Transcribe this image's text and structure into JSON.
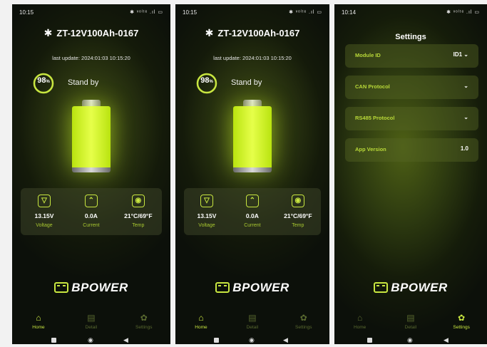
{
  "colors": {
    "accent": "#c8e640",
    "battery_fill": "#d8f830",
    "inactive_nav": "#5a6a30"
  },
  "home_screens": [
    {
      "status_time": "10:15",
      "status_icons": "✱ ᵛᵒˡᵗᵉ .ıl ▭",
      "device_title": "ZT-12V100Ah-0167",
      "bluetooth_icon": "bluetooth-icon",
      "last_update": "last update: 2024:01:03 10:15:20",
      "soc_value": "98",
      "soc_unit": "%",
      "soc_fraction": 0.98,
      "state": "Stand by",
      "metrics": [
        {
          "icon": "voltage-icon",
          "glyph": "▽",
          "value": "13.15V",
          "label": "Voltage"
        },
        {
          "icon": "current-icon",
          "glyph": "⌃",
          "value": "0.0A",
          "label": "Current"
        },
        {
          "icon": "thermometer-icon",
          "glyph": "◉",
          "value": "21°C/69°F",
          "label": "Temp"
        }
      ]
    },
    {
      "status_time": "10:15",
      "status_icons": "✱ ᵛᵒˡᵗᵉ .ıl ▭",
      "device_title": "ZT-12V100Ah-0167",
      "bluetooth_icon": "bluetooth-icon",
      "last_update": "last update: 2024:01:03 10:15:20",
      "soc_value": "98",
      "soc_unit": "%",
      "soc_fraction": 0.98,
      "state": "Stand by",
      "metrics": [
        {
          "icon": "voltage-icon",
          "glyph": "▽",
          "value": "13.15V",
          "label": "Voltage"
        },
        {
          "icon": "current-icon",
          "glyph": "⌃",
          "value": "0.0A",
          "label": "Current"
        },
        {
          "icon": "thermometer-icon",
          "glyph": "◉",
          "value": "21°C/69°F",
          "label": "Temp"
        }
      ]
    }
  ],
  "settings_screen": {
    "status_time": "10:14",
    "status_icons": "✱ ᵛᵒˡᵗᵉ .ıl ▭",
    "title": "Settings",
    "rows": [
      {
        "label": "Module ID",
        "value": "ID1 ⌄"
      },
      {
        "label": "CAN Protocol",
        "value": "⌄"
      },
      {
        "label": "RS485 Protocol",
        "value": "⌄"
      },
      {
        "label": "App Version",
        "value": "1.0"
      }
    ]
  },
  "brand": {
    "logo_text": "BPOWER",
    "logo_icon": "battery-logo-icon"
  },
  "nav": [
    {
      "label": "Home",
      "icon": "home-icon",
      "glyph": "⌂"
    },
    {
      "label": "Detail",
      "icon": "document-icon",
      "glyph": "▤"
    },
    {
      "label": "Settings",
      "icon": "gear-icon",
      "glyph": "✿"
    }
  ],
  "system_nav": {
    "back_icon": "back-triangle-icon",
    "home_icon": "home-circle-icon",
    "recents_icon": "recents-square-icon",
    "back_glyph": "◀",
    "home_glyph": "◉"
  }
}
